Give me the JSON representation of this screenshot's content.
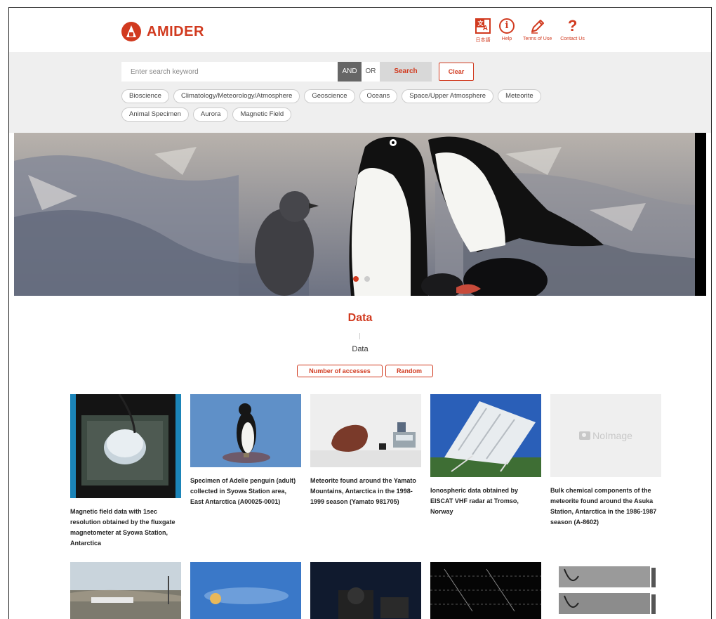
{
  "header": {
    "logo_text": "AMIDER",
    "nav": [
      {
        "icon": "japanese-language-icon",
        "label": "日本語"
      },
      {
        "icon": "info-icon",
        "label": "Help"
      },
      {
        "icon": "pencil-icon",
        "label": "Terms of Use"
      },
      {
        "icon": "question-icon",
        "label": "Contact Us"
      }
    ]
  },
  "search": {
    "placeholder": "Enter search keyword",
    "and_label": "AND",
    "or_label": "OR",
    "search_label": "Search",
    "clear_label": "Clear"
  },
  "categories": [
    "Bioscience",
    "Climatology/Meteorology/Atmosphere",
    "Geoscience",
    "Oceans",
    "Space/Upper Atmosphere",
    "Meteorite",
    "Animal Specimen",
    "Aurora",
    "Magnetic Field"
  ],
  "hero": {
    "slides": 2,
    "active_slide": 1
  },
  "section": {
    "title": "Data",
    "subtitle": "Data",
    "sort_buttons": [
      "Number of accesses",
      "Random"
    ]
  },
  "cards": [
    {
      "title": "Magnetic field data with 1sec resolution obtained by the fluxgate magnetometer at Syowa Station, Antarctica"
    },
    {
      "title": "Specimen of Adelie penguin (adult) collected in Syowa Station area, East Antarctica (A00025-0001)"
    },
    {
      "title": "Meteorite found around the Yamato Mountains, Antarctica in the 1998-1999 season (Yamato 981705)"
    },
    {
      "title": "Ionospheric data obtained by EISCAT VHF radar at Tromso, Norway"
    },
    {
      "title": "Bulk chemical components of the meteorite found around the Asuka Station, Antarctica in the 1986-1987 season (A-8602)",
      "no_image_label": "NoImage"
    }
  ],
  "colors": {
    "accent": "#d13a1f",
    "band": "#efefef"
  }
}
